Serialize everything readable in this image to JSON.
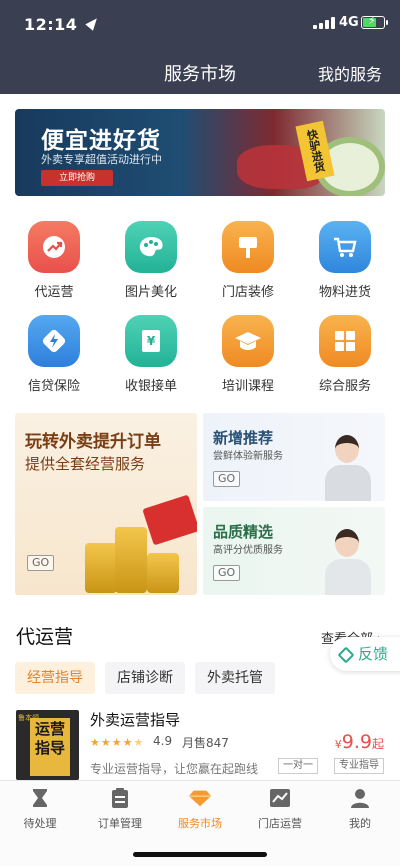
{
  "status": {
    "time": "12:14",
    "network": "4G"
  },
  "nav": {
    "title": "服务市场",
    "right": "我的服务"
  },
  "banner": {
    "title": "便宜进好货",
    "subtitle": "外卖专享超值活动进行中",
    "button": "立即抢购",
    "tag": "快驴进货"
  },
  "grid": [
    {
      "label": "代运营",
      "icon": "trend-up-icon",
      "color": "#ef5f52"
    },
    {
      "label": "图片美化",
      "icon": "palette-icon",
      "color": "#2fbfa5"
    },
    {
      "label": "门店装修",
      "icon": "paint-brush-icon",
      "color": "#f49a2f"
    },
    {
      "label": "物料进货",
      "icon": "cart-icon",
      "color": "#3a9be6"
    },
    {
      "label": "信贷保险",
      "icon": "lightning-shield-icon",
      "color": "#3a8fe6"
    },
    {
      "label": "收银接单",
      "icon": "yen-receipt-icon",
      "color": "#2fbfa5"
    },
    {
      "label": "培训课程",
      "icon": "graduation-cap-icon",
      "color": "#f49a2f"
    },
    {
      "label": "综合服务",
      "icon": "grid-icon",
      "color": "#f49a2f"
    }
  ],
  "promos": {
    "main": {
      "title": "玩转外卖提升订单",
      "subtitle": "提供全套经营服务",
      "go": "GO"
    },
    "new": {
      "title": "新增推荐",
      "subtitle": "尝鲜体验新服务",
      "go": "GO"
    },
    "quality": {
      "title": "品质精选",
      "subtitle": "高评分优质服务",
      "go": "GO"
    }
  },
  "section": {
    "title": "代运营",
    "more": "查看全部 ›",
    "feedback": "反馈"
  },
  "tabs": [
    {
      "label": "经营指导",
      "active": true
    },
    {
      "label": "店铺诊断",
      "active": false
    },
    {
      "label": "外卖托管",
      "active": false
    }
  ],
  "product": {
    "name": "外卖运营指导",
    "image_text": "运营指导",
    "image_badge": "鲁本领",
    "rating": "4.9",
    "stars": 4.5,
    "sold": "月售847",
    "desc": "专业运营指导，让您赢在起跑线",
    "price_currency": "¥",
    "price": "9.9",
    "price_unit": "起",
    "tags": [
      "一对一",
      "专业指导"
    ]
  },
  "tabbar": [
    {
      "label": "待处理",
      "icon": "hourglass-icon",
      "active": false
    },
    {
      "label": "订单管理",
      "icon": "clipboard-icon",
      "active": false
    },
    {
      "label": "服务市场",
      "icon": "diamond-icon",
      "active": true
    },
    {
      "label": "门店运营",
      "icon": "chart-icon",
      "active": false
    },
    {
      "label": "我的",
      "icon": "person-icon",
      "active": false
    }
  ],
  "colors": {
    "header": "#3b3f52",
    "accent": "#f49a2f",
    "price": "#e8504c",
    "feedback": "#2daa8e",
    "active_tab_bg": "#fdf0dc",
    "active_tab_text": "#e8832a"
  }
}
